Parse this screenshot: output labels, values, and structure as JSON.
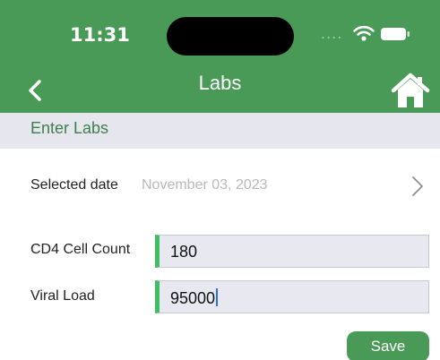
{
  "status_bar": {
    "time": "11:31",
    "signal": "....",
    "icons": [
      "wifi-icon",
      "battery-icon"
    ]
  },
  "nav": {
    "title": "Labs",
    "back_icon": "chevron-left-icon",
    "home_icon": "home-icon"
  },
  "section": {
    "title": "Enter Labs"
  },
  "date_row": {
    "label": "Selected date",
    "value": "November 03, 2023"
  },
  "fields": [
    {
      "label": "CD4 Cell Count",
      "value": "180"
    },
    {
      "label": "Viral Load",
      "value": "95000"
    }
  ],
  "save_label": "Save",
  "colors": {
    "brand_green": "#4a9a57",
    "input_accent": "#3cc060",
    "section_bg": "#e6e6ee",
    "input_bg": "#e8e8f0"
  }
}
